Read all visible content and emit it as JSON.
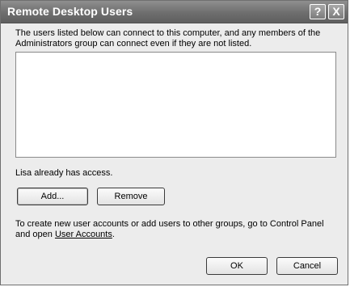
{
  "window": {
    "title": "Remote Desktop Users",
    "help_glyph": "?",
    "close_glyph": "X"
  },
  "description": "The users listed below can connect to this computer, and any members of the Administrators group can connect even if they are not listed.",
  "users_list": [],
  "access_status": "Lisa already has access.",
  "buttons": {
    "add": "Add...",
    "remove": "Remove",
    "ok": "OK",
    "cancel": "Cancel"
  },
  "footer": {
    "text_before": "To create new user accounts or add users to other groups, go to Control Panel and open ",
    "link": "User Accounts",
    "text_after": "."
  },
  "icons": {
    "help": "help-icon",
    "close": "close-icon"
  }
}
